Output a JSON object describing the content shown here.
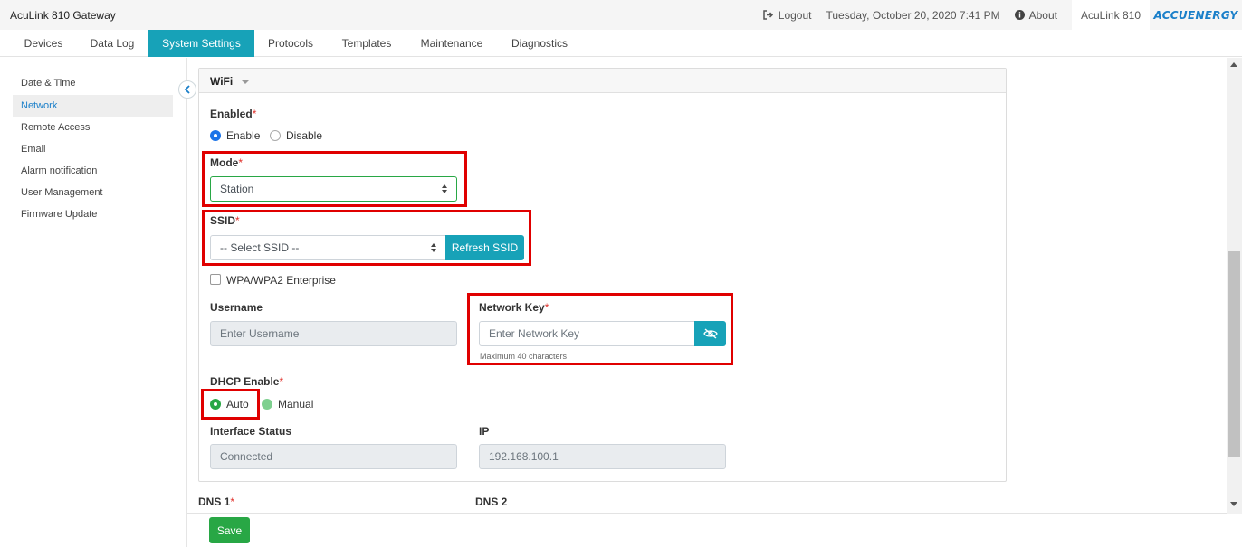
{
  "app": {
    "title": "AcuLink 810 Gateway"
  },
  "topbar": {
    "logout": "Logout",
    "datetime": "Tuesday, October 20, 2020 7:41 PM",
    "about": "About",
    "device": "AcuLink 810",
    "logo": "ACCUENERGY"
  },
  "nav": {
    "tabs": [
      "Devices",
      "Data Log",
      "System Settings",
      "Protocols",
      "Templates",
      "Maintenance",
      "Diagnostics"
    ],
    "active": "System Settings"
  },
  "sidebar": {
    "items": [
      "Date & Time",
      "Network",
      "Remote Access",
      "Email",
      "Alarm notification",
      "User Management",
      "Firmware Update"
    ],
    "active": "Network"
  },
  "wifi": {
    "title": "WiFi",
    "required_mark": "*",
    "enabled_label": "Enabled",
    "enable_option": "Enable",
    "disable_option": "Disable",
    "enabled_value": "Enable",
    "mode_label": "Mode",
    "mode_value": "Station",
    "ssid_label": "SSID",
    "ssid_value": "-- Select SSID --",
    "refresh_ssid": "Refresh SSID",
    "wpa_enterprise": "WPA/WPA2 Enterprise",
    "wpa_enterprise_checked": false,
    "username_label": "Username",
    "username_placeholder": "Enter Username",
    "network_key_label": "Network Key",
    "network_key_placeholder": "Enter Network Key",
    "network_key_hint": "Maximum 40 characters",
    "dhcp_label": "DHCP Enable",
    "dhcp_auto": "Auto",
    "dhcp_manual": "Manual",
    "dhcp_value": "Auto",
    "interface_status_label": "Interface Status",
    "interface_status_value": "Connected",
    "ip_label": "IP",
    "ip_value": "192.168.100.1"
  },
  "dns": {
    "dns1_label": "DNS 1",
    "dns2_label": "DNS 2"
  },
  "actions": {
    "save": "Save"
  },
  "colors": {
    "accent": "#17a2b8",
    "save": "#28a745",
    "highlight": "#e00000",
    "link": "#1a7fc9"
  }
}
